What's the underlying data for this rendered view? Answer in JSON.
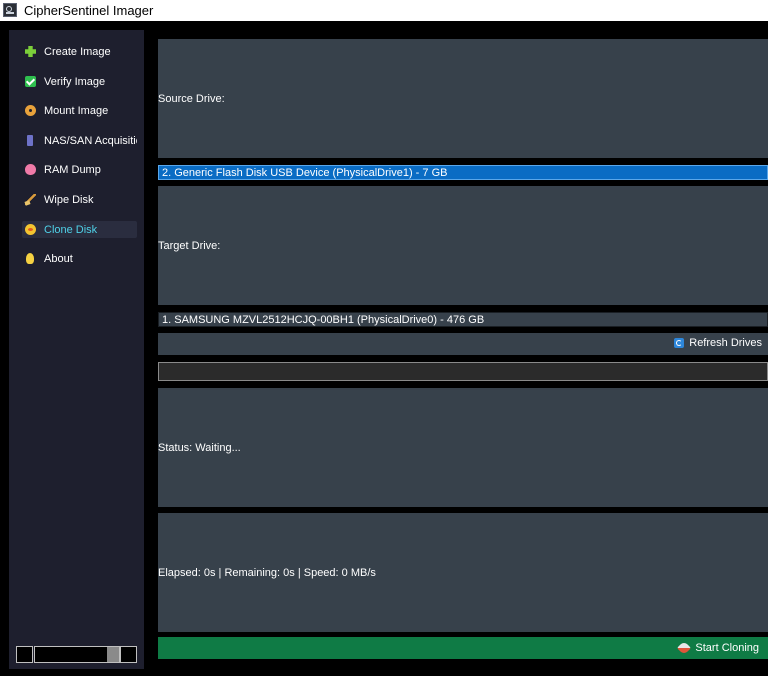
{
  "window": {
    "title": "CipherSentinel Imager"
  },
  "sidebar": {
    "items": [
      {
        "label": "Create Image",
        "icon": "puzzle-icon",
        "active": false
      },
      {
        "label": "Verify Image",
        "icon": "check-icon",
        "active": false
      },
      {
        "label": "Mount Image",
        "icon": "disc-icon",
        "active": false
      },
      {
        "label": "NAS/SAN Acquisitic",
        "icon": "server-icon",
        "active": false
      },
      {
        "label": "RAM Dump",
        "icon": "brain-icon",
        "active": false
      },
      {
        "label": "Wipe Disk",
        "icon": "broom-icon",
        "active": false
      },
      {
        "label": "Clone Disk",
        "icon": "cd-icon",
        "active": true
      },
      {
        "label": "About",
        "icon": "bulb-icon",
        "active": false
      }
    ]
  },
  "main": {
    "source_label": "Source Drive:",
    "source_value": "2. Generic Flash Disk USB Device (PhysicalDrive1) - 7 GB",
    "target_label": "Target Drive:",
    "target_value": "1. SAMSUNG MZVL2512HCJQ-00BH1 (PhysicalDrive0) - 476 GB",
    "refresh_label": "Refresh Drives",
    "progress": 0,
    "status": "Status: Waiting...",
    "stats": "Elapsed: 0s | Remaining: 0s | Speed: 0 MB/s",
    "start_label": "Start Cloning"
  },
  "colors": {
    "sidebar_bg": "#1e1f2e",
    "panel_bg": "#37414b",
    "selected_bg": "#0a6cc4",
    "active_text": "#4fd1e8",
    "start_bg": "#0f7b45"
  }
}
